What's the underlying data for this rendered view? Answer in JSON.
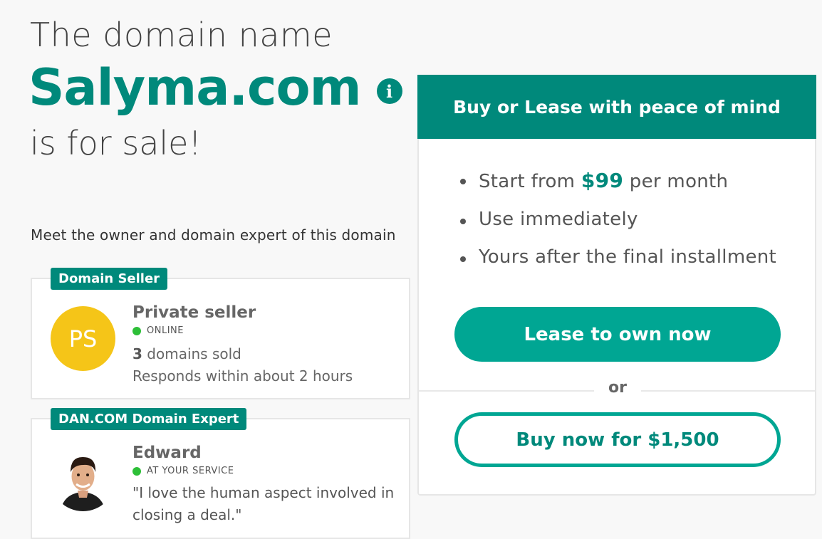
{
  "hero": {
    "line1": "The domain name",
    "domain": "Salyma.com",
    "line3": "is for sale!",
    "info_icon": "info-icon"
  },
  "owner_intro": "Meet the owner and domain expert of this domain",
  "seller": {
    "tag": "Domain Seller",
    "initials": "PS",
    "name": "Private seller",
    "status": "ONLINE",
    "domains_sold_count": "3",
    "domains_sold_label": " domains sold",
    "responds": "Responds within about 2 hours"
  },
  "expert": {
    "tag": "DAN.COM Domain Expert",
    "name": "Edward",
    "status": "AT YOUR SERVICE",
    "quote": "\"I love the human aspect involved in closing a deal.\""
  },
  "panel": {
    "header": "Buy or Lease with peace of mind",
    "benefit1_prefix": "Start from ",
    "benefit1_price": "$99",
    "benefit1_suffix": " per month",
    "benefit2": "Use immediately",
    "benefit3": "Yours after the final installment",
    "lease_button": "Lease to own now",
    "or": "or",
    "buy_button": "Buy now for $1,500"
  },
  "colors": {
    "accent": "#00897b",
    "button": "#00a693",
    "avatar_yellow": "#f5c518",
    "online_green": "#2dbf38"
  }
}
